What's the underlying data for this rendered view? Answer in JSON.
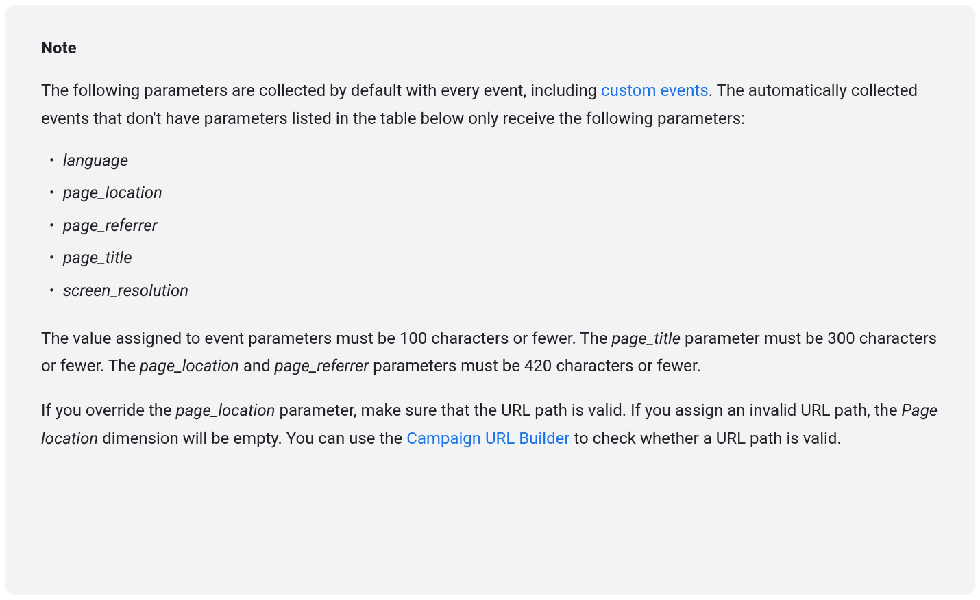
{
  "note": {
    "title": "Note",
    "paragraph1": {
      "text_before_link": "The following parameters are collected by default with every event, including ",
      "link1": "custom events",
      "text_after_link": ". The automatically collected events that don't have parameters listed in the table below only receive the following parameters:"
    },
    "list": [
      "language",
      "page_location",
      "page_referrer",
      "page_title",
      "screen_resolution"
    ],
    "paragraph2": {
      "t1": "The value assigned to event parameters must be 100 characters or fewer. The ",
      "i1": "page_title",
      "t2": " parameter must be 300 characters or fewer. The ",
      "i2": "page_location",
      "t3": " and ",
      "i3": "page_referrer",
      "t4": " parameters must be 420 characters or fewer."
    },
    "paragraph3": {
      "t1": "If you override the ",
      "i1": "page_location",
      "t2": " parameter, make sure that the URL path is valid. If you assign an invalid URL path, the ",
      "i2": "Page location",
      "t3": " dimension will be empty. You can use the ",
      "link1": "Campaign URL Builder",
      "t4": " to check whether a URL path is valid."
    }
  }
}
